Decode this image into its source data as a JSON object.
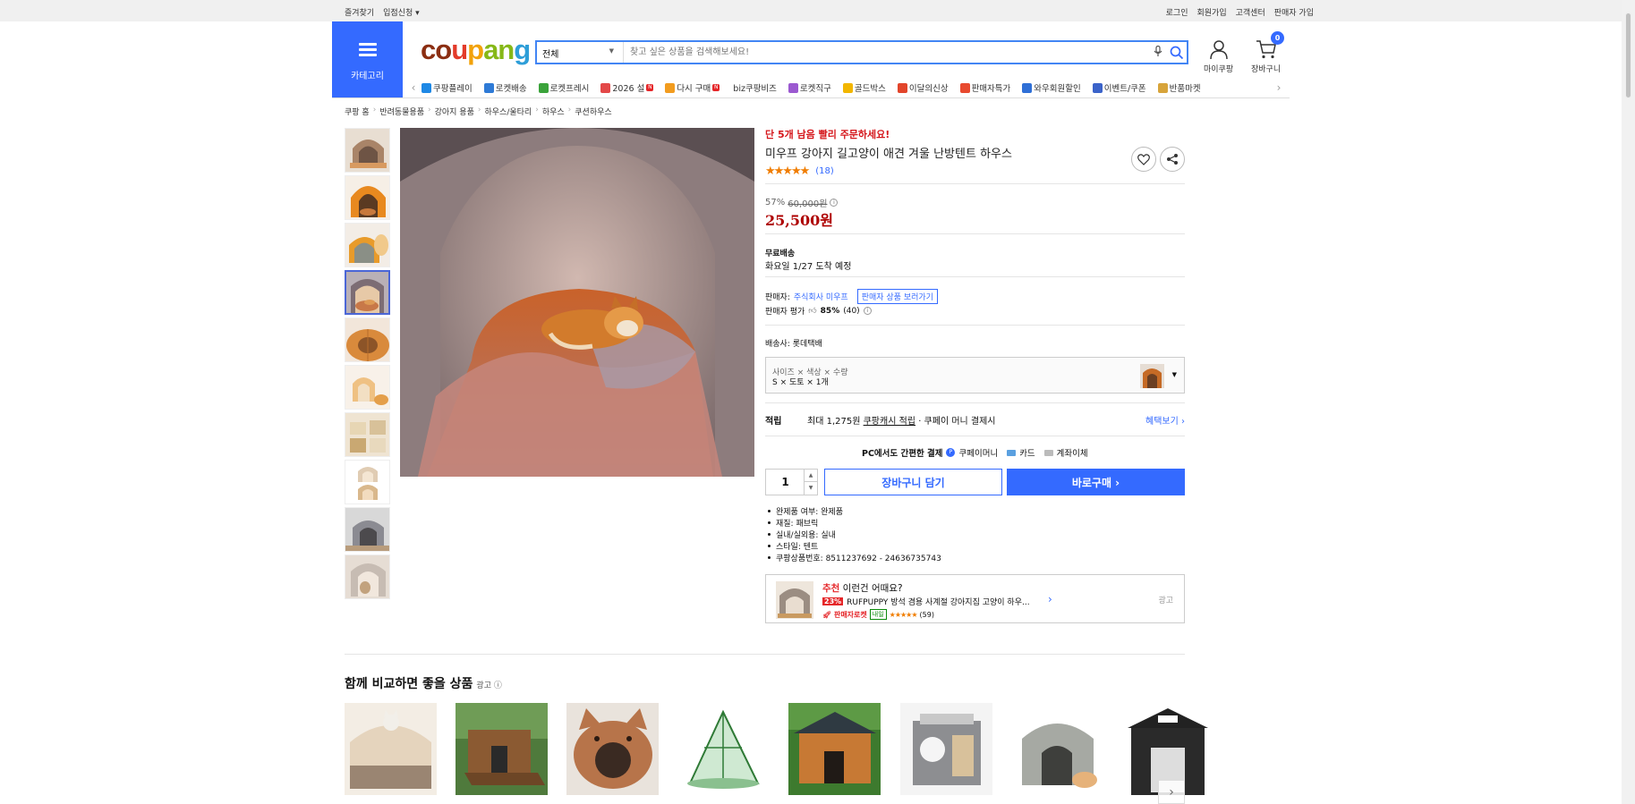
{
  "topbar": {
    "left": [
      "즐겨찾기",
      "입점신청 ▾"
    ],
    "right": [
      "로그인",
      "회원가입",
      "고객센터",
      "판매자 가입"
    ]
  },
  "header": {
    "category_label": "카테고리",
    "logo": [
      "co",
      "u",
      "p",
      "an",
      "g"
    ],
    "search_scope": "전체",
    "search_placeholder": "찾고 싶은 상품을 검색해보세요!",
    "mypage_label": "마이쿠팡",
    "cart_label": "장바구니",
    "cart_count": "0"
  },
  "nav": [
    {
      "label": "쿠팡플레이",
      "color": "#1e88e5"
    },
    {
      "label": "로켓배송",
      "color": "#2e7ad6"
    },
    {
      "label": "로켓프레시",
      "color": "#3ba33b"
    },
    {
      "label": "2026 설",
      "color": "#e34848",
      "new": true
    },
    {
      "label": "다시 구매",
      "color": "#f29c1f",
      "new": true
    },
    {
      "label": "biz쿠팡비즈",
      "color": "#ffffff"
    },
    {
      "label": "로켓직구",
      "color": "#9b59d0"
    },
    {
      "label": "골드박스",
      "color": "#f2b600"
    },
    {
      "label": "이달의신상",
      "color": "#e2452b"
    },
    {
      "label": "판매자특가",
      "color": "#e84a2f"
    },
    {
      "label": "와우회원할인",
      "color": "#2f6fd6"
    },
    {
      "label": "이벤트/쿠폰",
      "color": "#3b63c9"
    },
    {
      "label": "반품마켓",
      "color": "#d7a43b"
    }
  ],
  "breadcrumb": [
    "쿠팡 홈",
    "반려동물용품",
    "강아지 용품",
    "하우스/울타리",
    "하우스",
    "쿠션하우스"
  ],
  "product": {
    "urgent": "단 5개 남음 빨리 주문하세요!",
    "title": "미우프 강아지 길고양이 애견 겨울 난방텐트 하우스",
    "stars": "★★★★★",
    "review_count": "(18)",
    "discount_rate": "57%",
    "original_price": "60,000원",
    "price": "25,500원",
    "shipping_label": "무료배송",
    "delivery": "화요일 1/27 도착 예정",
    "seller_label": "판매자:",
    "seller_name": "주식회사 미우프",
    "seller_more": "판매자 상품 보러가기",
    "seller_rating_label": "판매자 평가",
    "seller_rating": "85%",
    "seller_rating_count": "(40)",
    "courier": "배송사: 롯데택배",
    "option_header": "사이즈 × 색상 × 수량",
    "option_value": "S × 도토 × 1개",
    "reward_label": "적립",
    "reward_text": "최대 1,275원",
    "reward_link": "쿠팡캐시 적립",
    "reward_tail": "· 쿠페이 머니 결제시",
    "reward_more": "혜택보기 ›",
    "pay_title": "PC에서도 간편한 결제",
    "pay_methods": [
      "쿠페이머니",
      "카드",
      "계좌이체"
    ],
    "quantity": "1",
    "cart_button": "장바구니 담기",
    "buy_button": "바로구매 ›",
    "specs": [
      "완제품 여부: 완제품",
      "재질: 패브릭",
      "실내/실외용: 실내",
      "스타일: 텐트",
      "쿠팡상품번호: 8511237692 - 24636735743"
    ]
  },
  "recommend": {
    "title_prefix": "추천",
    "title": "이런건 어때요?",
    "discount": "23%",
    "name": "RUFPUPPY 방석 겸용 사계절 강아지집 고양이 하우...",
    "tag": "판매자로켓",
    "tag2": "내일",
    "stars": "★★★★★",
    "count": "(59)",
    "ad": "광고"
  },
  "compare": {
    "title": "함께 비교하면 좋을 상품",
    "ad": "광고"
  },
  "colors": {
    "accent": "#346aff",
    "price": "#ae0000",
    "urgent": "#d5161b",
    "star": "#f07d00"
  }
}
